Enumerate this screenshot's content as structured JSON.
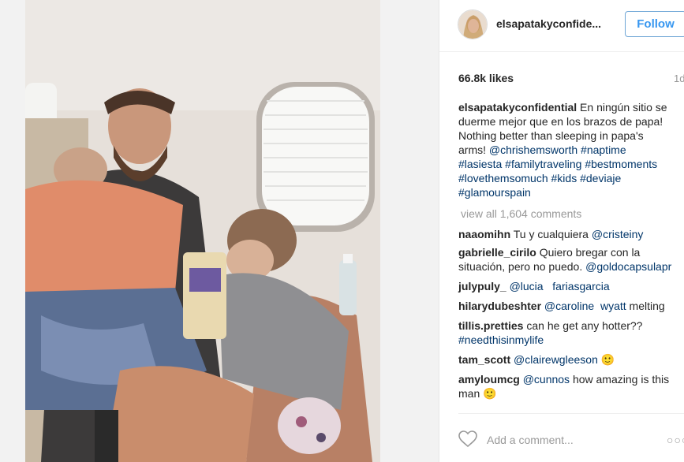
{
  "post": {
    "username": "elsapatakyconfide...",
    "follow_label": "Follow",
    "likes": "66.8k likes",
    "timestamp": "1d"
  },
  "caption": {
    "username": "elsapatakyconfidential",
    "text": " En ningún sitio se duerme mejor que en los brazos de papa! Nothing better than sleeping in papa's arms! ",
    "mentions_and_tags": [
      "@chrishemsworth",
      "#naptime",
      "#lasiesta",
      "#familytraveling",
      "#bestmoments",
      "#lovethemsomuch",
      "#kids",
      "#deviaje",
      "#glamourspain"
    ]
  },
  "view_all_comments": "view all 1,604 comments",
  "comments": [
    {
      "user": "naaomihn",
      "text": "Tu y cualquiera ",
      "tags": [
        "@cristeiny"
      ]
    },
    {
      "user": "gabrielle_cirilo",
      "text": "Quiero bregar con la situación, pero no puedo. ",
      "tags": [
        "@goldocapsulapr"
      ]
    },
    {
      "user": "julypuly_",
      "text": "",
      "tags": [
        "@lucia",
        "fariasgarcia"
      ]
    },
    {
      "user": "hilarydubeshter",
      "text": "",
      "tags": [
        "@caroline",
        "wyatt"
      ],
      "suffix": " melting"
    },
    {
      "user": "tillis.pretties",
      "text": "can he get any hotter?? ",
      "tags": [
        "#needthisinmylife"
      ]
    },
    {
      "user": "tam_scott",
      "text": "",
      "tags": [
        "@clairewgleeson"
      ],
      "suffix": " 🙂"
    },
    {
      "user": "amyloumcg",
      "text": "",
      "tags": [
        "@cunnos"
      ],
      "suffix": " how amazing is this man 🙂"
    }
  ],
  "add_comment_placeholder": "Add a comment...",
  "more_label": "○○○",
  "icons": {
    "heart": "heart-icon",
    "more": "more-options-icon"
  }
}
